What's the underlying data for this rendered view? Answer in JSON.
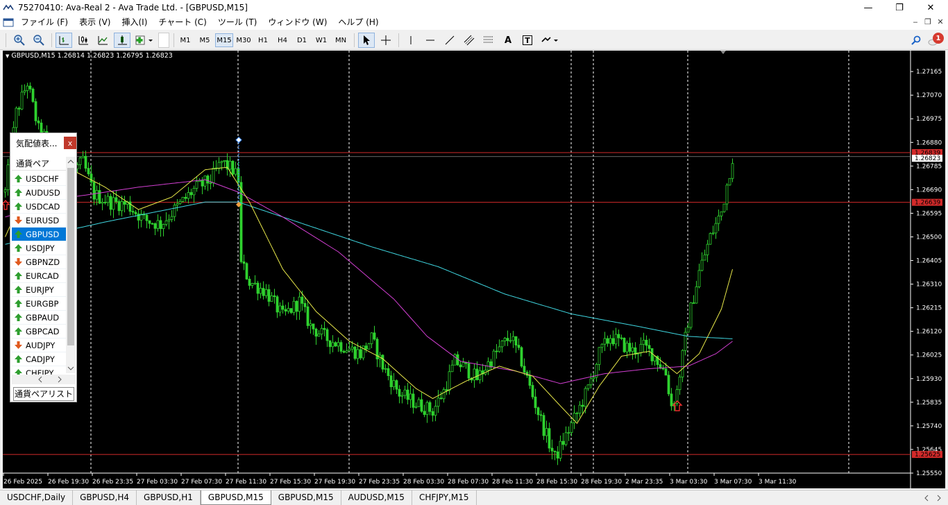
{
  "window": {
    "title": "75270410: Ava-Real 2 - Ava Trade Ltd. - [GBPUSD,M15]",
    "min_glyph": "—",
    "max_glyph": "❐",
    "close_glyph": "✕"
  },
  "menu": [
    "ファイル (F)",
    "表示 (V)",
    "挿入(I)",
    "チャート (C)",
    "ツール (T)",
    "ウィンドウ (W)",
    "ヘルプ (H)"
  ],
  "mdi_controls": [
    "‒",
    "❐",
    "✕"
  ],
  "toolbar": {
    "timeframes": [
      "M1",
      "M5",
      "M15",
      "M30",
      "H1",
      "H4",
      "D1",
      "W1",
      "MN"
    ],
    "active_timeframe": "M15",
    "text_tool": "A",
    "label_tool": "T",
    "notification_count": "1"
  },
  "chart": {
    "header": "GBPUSD,M15  1.26814 1.26823 1.26795 1.26823"
  },
  "market_watch": {
    "title": "気配値表...",
    "close_label": "x",
    "column_header": "通貨ペア",
    "rows": [
      {
        "symbol": "USDCHF",
        "dir": "up"
      },
      {
        "symbol": "AUDUSD",
        "dir": "up"
      },
      {
        "symbol": "USDCAD",
        "dir": "up"
      },
      {
        "symbol": "EURUSD",
        "dir": "down"
      },
      {
        "symbol": "GBPUSD",
        "dir": "up",
        "selected": true
      },
      {
        "symbol": "USDJPY",
        "dir": "up"
      },
      {
        "symbol": "GBPNZD",
        "dir": "down"
      },
      {
        "symbol": "EURCAD",
        "dir": "up"
      },
      {
        "symbol": "EURJPY",
        "dir": "up"
      },
      {
        "symbol": "EURGBP",
        "dir": "up"
      },
      {
        "symbol": "GBPAUD",
        "dir": "up"
      },
      {
        "symbol": "GBPCAD",
        "dir": "up"
      },
      {
        "symbol": "AUDJPY",
        "dir": "down"
      },
      {
        "symbol": "CADJPY",
        "dir": "up"
      },
      {
        "symbol": "CHFJPY",
        "dir": "up"
      }
    ],
    "tab_label": "通貨ペアリスト"
  },
  "tabs": [
    {
      "label": "USDCHF,Daily"
    },
    {
      "label": "GBPUSD,H4"
    },
    {
      "label": "GBPUSD,H1"
    },
    {
      "label": "GBPUSD,M15",
      "active": true
    },
    {
      "label": "GBPUSD,M15"
    },
    {
      "label": "AUDUSD,M15"
    },
    {
      "label": "CHFJPY,M15"
    }
  ],
  "chart_data": {
    "type": "candlestick",
    "symbol": "GBPUSD",
    "timeframe": "M15",
    "ylim": [
      1.2555,
      1.2721
    ],
    "y_ticks": [
      "1.27165",
      "1.27070",
      "1.26975",
      "1.26880",
      "1.26785",
      "1.26690",
      "1.26595",
      "1.26500",
      "1.26405",
      "1.26310",
      "1.26215",
      "1.26120",
      "1.26025",
      "1.25930",
      "1.25835",
      "1.25740",
      "1.25645",
      "1.25550"
    ],
    "x_ticks": [
      "26 Feb 2025",
      "26 Feb 19:30",
      "26 Feb 23:35",
      "27 Feb 03:30",
      "27 Feb 07:30",
      "27 Feb 11:30",
      "27 Feb 15:30",
      "27 Feb 19:30",
      "27 Feb 23:35",
      "28 Feb 03:30",
      "28 Feb 07:30",
      "28 Feb 11:30",
      "28 Feb 15:30",
      "28 Feb 19:30",
      "2 Mar 23:35",
      "3 Mar 03:30",
      "3 Mar 07:30",
      "3 Mar 11:30"
    ],
    "price_labels": {
      "top_line": "1.26839",
      "current": "1.26823",
      "middle_line": "1.26639",
      "bottom_line": "1.25625"
    },
    "horizontal_lines": [
      1.26839,
      1.26639,
      1.25625
    ],
    "current_price": 1.26823,
    "path": [
      [
        0,
        1.2668
      ],
      [
        4,
        1.27
      ],
      [
        8,
        1.2712
      ],
      [
        12,
        1.2693
      ],
      [
        16,
        1.2688
      ],
      [
        20,
        1.2679
      ],
      [
        24,
        1.2676
      ],
      [
        28,
        1.268
      ],
      [
        32,
        1.2667
      ],
      [
        38,
        1.2664
      ],
      [
        44,
        1.2663
      ],
      [
        50,
        1.2657
      ],
      [
        56,
        1.2655
      ],
      [
        62,
        1.2662
      ],
      [
        68,
        1.2669
      ],
      [
        74,
        1.2673
      ],
      [
        78,
        1.268
      ],
      [
        82,
        1.2677
      ],
      [
        84,
        1.2673
      ],
      [
        85,
        1.264
      ],
      [
        88,
        1.2632
      ],
      [
        94,
        1.2628
      ],
      [
        100,
        1.2618
      ],
      [
        106,
        1.2624
      ],
      [
        110,
        1.2614
      ],
      [
        116,
        1.2609
      ],
      [
        122,
        1.2606
      ],
      [
        128,
        1.2603
      ],
      [
        132,
        1.2609
      ],
      [
        136,
        1.2598
      ],
      [
        142,
        1.2587
      ],
      [
        148,
        1.2583
      ],
      [
        154,
        1.258
      ],
      [
        158,
        1.2588
      ],
      [
        162,
        1.26
      ],
      [
        166,
        1.2597
      ],
      [
        170,
        1.2593
      ],
      [
        174,
        1.2599
      ],
      [
        178,
        1.2605
      ],
      [
        182,
        1.261
      ],
      [
        186,
        1.26
      ],
      [
        190,
        1.2586
      ],
      [
        194,
        1.2573
      ],
      [
        198,
        1.2561
      ],
      [
        202,
        1.257
      ],
      [
        206,
        1.2579
      ],
      [
        210,
        1.2589
      ],
      [
        214,
        1.2603
      ],
      [
        218,
        1.261
      ],
      [
        222,
        1.2607
      ],
      [
        226,
        1.2604
      ],
      [
        230,
        1.2606
      ],
      [
        234,
        1.2602
      ],
      [
        238,
        1.2595
      ],
      [
        240,
        1.2582
      ],
      [
        242,
        1.2588
      ],
      [
        246,
        1.2616
      ],
      [
        250,
        1.2636
      ],
      [
        254,
        1.265
      ],
      [
        258,
        1.266
      ],
      [
        262,
        1.2682
      ]
    ],
    "yellow_ma": [
      [
        0,
        1.265
      ],
      [
        12,
        1.268
      ],
      [
        24,
        1.2677
      ],
      [
        36,
        1.267
      ],
      [
        48,
        1.2661
      ],
      [
        60,
        1.2666
      ],
      [
        72,
        1.2677
      ],
      [
        80,
        1.2678
      ],
      [
        88,
        1.2664
      ],
      [
        100,
        1.2637
      ],
      [
        112,
        1.262
      ],
      [
        124,
        1.2608
      ],
      [
        136,
        1.2601
      ],
      [
        148,
        1.2589
      ],
      [
        154,
        1.2585
      ],
      [
        166,
        1.2592
      ],
      [
        178,
        1.2598
      ],
      [
        190,
        1.2594
      ],
      [
        200,
        1.2582
      ],
      [
        206,
        1.2575
      ],
      [
        214,
        1.259
      ],
      [
        222,
        1.2602
      ],
      [
        232,
        1.2604
      ],
      [
        242,
        1.2595
      ],
      [
        250,
        1.2603
      ],
      [
        258,
        1.2621
      ],
      [
        262,
        1.2637
      ]
    ],
    "magenta_ma": [
      [
        0,
        1.2658
      ],
      [
        24,
        1.2666
      ],
      [
        48,
        1.267
      ],
      [
        72,
        1.2673
      ],
      [
        84,
        1.2668
      ],
      [
        100,
        1.2658
      ],
      [
        120,
        1.2644
      ],
      [
        140,
        1.2625
      ],
      [
        152,
        1.261
      ],
      [
        164,
        1.26
      ],
      [
        184,
        1.2596
      ],
      [
        200,
        1.2591
      ],
      [
        216,
        1.2595
      ],
      [
        232,
        1.2597
      ],
      [
        246,
        1.2598
      ],
      [
        256,
        1.2603
      ],
      [
        262,
        1.2608
      ]
    ],
    "cyan_ma": [
      [
        0,
        1.2647
      ],
      [
        36,
        1.2656
      ],
      [
        72,
        1.2664
      ],
      [
        84,
        1.2664
      ],
      [
        108,
        1.2655
      ],
      [
        132,
        1.2646
      ],
      [
        156,
        1.2638
      ],
      [
        180,
        1.2627
      ],
      [
        204,
        1.2619
      ],
      [
        228,
        1.2614
      ],
      [
        246,
        1.261
      ],
      [
        262,
        1.2609
      ]
    ],
    "session_separators": [
      31,
      84,
      124,
      204,
      212,
      246,
      304
    ]
  }
}
